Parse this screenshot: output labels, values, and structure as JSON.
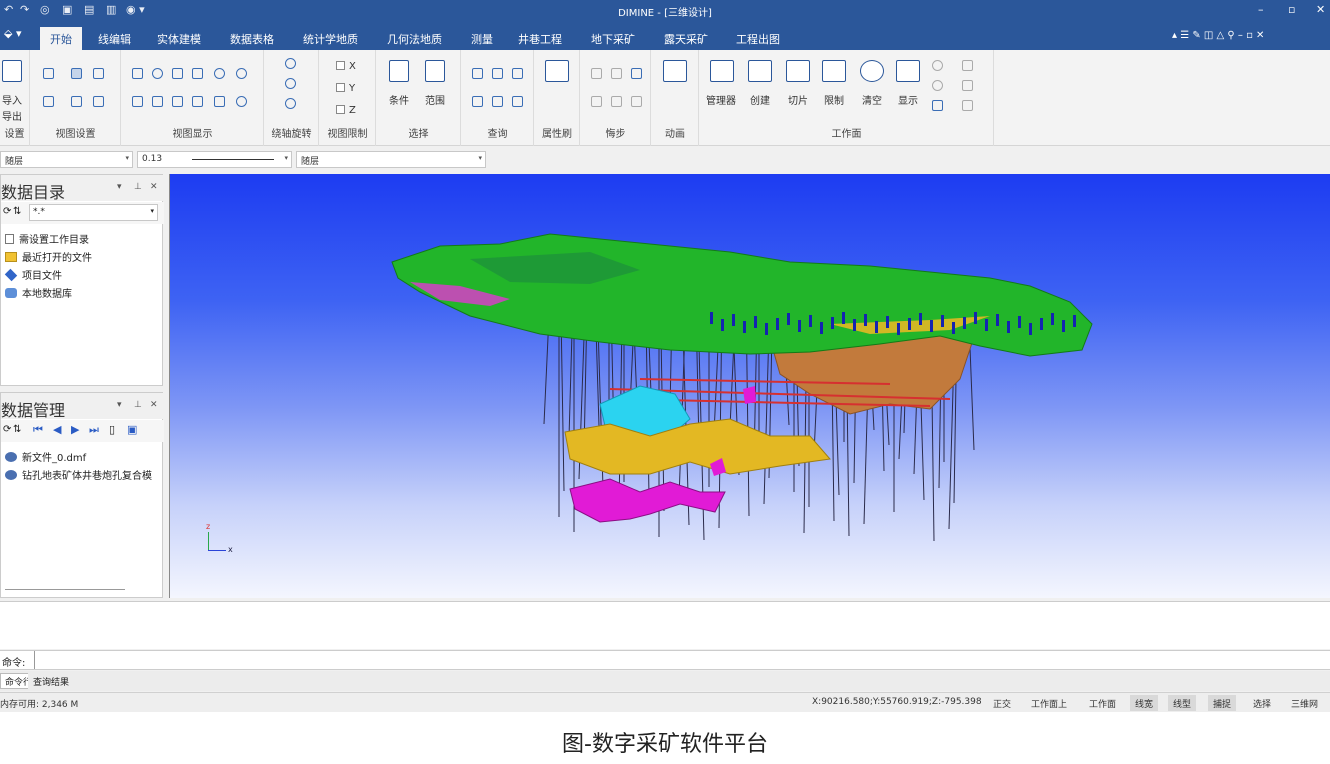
{
  "window": {
    "title": "DIMINE - [三维设计]",
    "win_buttons": [
      "–",
      "▫",
      "✕"
    ]
  },
  "tabs": [
    {
      "label": "开始",
      "active": true
    },
    {
      "label": "线编辑"
    },
    {
      "label": "实体建模"
    },
    {
      "label": "数据表格"
    },
    {
      "label": "统计学地质"
    },
    {
      "label": "几何法地质"
    },
    {
      "label": "测量"
    },
    {
      "label": "井巷工程"
    },
    {
      "label": "地下采矿"
    },
    {
      "label": "露天采矿"
    },
    {
      "label": "工程出图"
    }
  ],
  "ribbon": {
    "groups": [
      {
        "label": "设置",
        "buttons": [
          "导入",
          "导出"
        ]
      },
      {
        "label": "视图设置"
      },
      {
        "label": "视图显示"
      },
      {
        "label": "绕轴旋转"
      },
      {
        "label": "视图限制",
        "checks": [
          "X",
          "Y",
          "Z"
        ]
      },
      {
        "label": "选择",
        "buttons": [
          "条件",
          "范围"
        ]
      },
      {
        "label": "查询"
      },
      {
        "label": "属性刷"
      },
      {
        "label": "悔步"
      },
      {
        "label": "动画"
      },
      {
        "label": "工作面",
        "buttons": [
          "管理器",
          "创建",
          "切片",
          "限制",
          "清空",
          "显示"
        ]
      }
    ]
  },
  "propbar": {
    "layer": "随层",
    "linewidth": "0.13",
    "color": "随层"
  },
  "catalog_panel": {
    "title": "数据目录",
    "filter": "*.*",
    "items": [
      "需设置工作目录",
      "最近打开的文件",
      "项目文件",
      "本地数据库"
    ]
  },
  "data_panel": {
    "title": "数据管理",
    "items": [
      "新文件_0.dmf",
      "钻孔地表矿体井巷炮孔复合模"
    ]
  },
  "axis": {
    "z": "z",
    "x": "x"
  },
  "cmdline": {
    "label": "命令:"
  },
  "cmdtabs": [
    "命令行",
    "查询结果"
  ],
  "status": {
    "memory": "内存可用: 2,346 M",
    "coords": "X:90216.580;Y:55760.919;Z:-795.398",
    "buttons": [
      {
        "label": "正交",
        "on": false
      },
      {
        "label": "工作面上",
        "on": false
      },
      {
        "label": "工作面",
        "on": false
      },
      {
        "label": "线宽",
        "on": true
      },
      {
        "label": "线型",
        "on": true
      },
      {
        "label": "捕捉",
        "on": true
      },
      {
        "label": "选择",
        "on": false
      },
      {
        "label": "三维网格",
        "on": false
      }
    ]
  },
  "caption": "图-数字采矿软件平台",
  "colors": {
    "accent": "#2b579a",
    "terrain": "#22b52a",
    "orebody_gold": "#e3b823",
    "orebody_magenta": "#e11bd6",
    "orebody_cyan": "#2bd3f0",
    "orebody_brown": "#c27a3c"
  }
}
